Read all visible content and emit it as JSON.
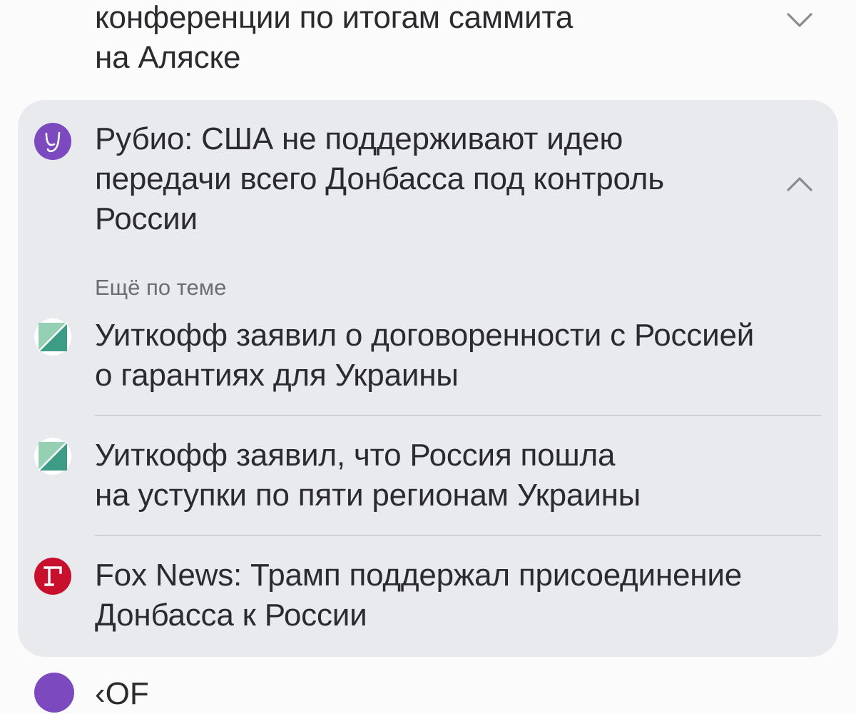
{
  "top_item": {
    "title": "конференции по итогам саммита\nна Аляске",
    "chevron": "chevron-down-icon"
  },
  "main_item": {
    "source_icon": "yandex-logo-icon",
    "source_color": "#7d49bf",
    "title": "Рубио: США не поддерживают идею\nпередачи всего Донбасса под контроль\nРоссии",
    "chevron": "chevron-up-icon"
  },
  "related": {
    "label": "Ещё по теме",
    "items": [
      {
        "source_icon": "publisher-logo-teal-icon",
        "title": "Уиткофф заявил о договоренности с Россией\nо гарантиях для Украины"
      },
      {
        "source_icon": "publisher-logo-teal-icon",
        "title": "Уиткофф заявил, что Россия пошла\nна уступки по пяти регионам Украины"
      },
      {
        "source_icon": "publisher-logo-red-g-icon",
        "source_color": "#c8102e",
        "title": "Fox News: Трамп поддержал присоединение\nДонбасса к России"
      }
    ]
  },
  "peek_item": {
    "source_icon": "yandex-logo-icon",
    "title": "‹OF"
  }
}
